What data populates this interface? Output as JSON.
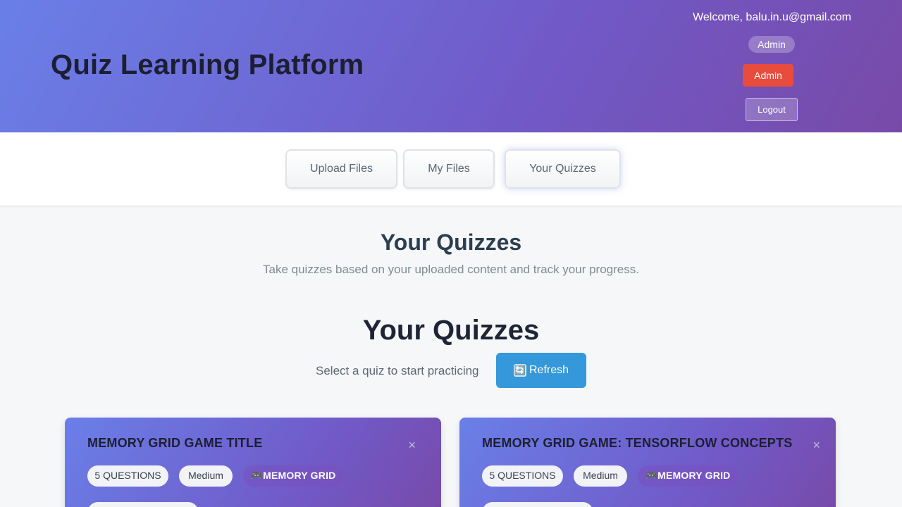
{
  "header": {
    "title": "Quiz Learning Platform",
    "welcome": "Welcome, balu.in.u@gmail.com",
    "role_badge": "Admin",
    "admin_button": "Admin",
    "logout_button": "Logout",
    "colors": {
      "gradient_start": "#6a7fe8",
      "gradient_end": "#784aa8",
      "admin": "#e74c3c"
    }
  },
  "nav": {
    "tabs": [
      {
        "label": "Upload Files"
      },
      {
        "label": "My Files"
      },
      {
        "label": "Your Quizzes"
      }
    ]
  },
  "page": {
    "heading": "Your Quizzes",
    "subtitle": "Take quizzes based on your uploaded content and track your progress."
  },
  "quizzes": {
    "heading": "Your Quizzes",
    "select_text": "Select a quiz to start practicing",
    "refresh_label": "Refresh",
    "refresh_icon": "🔄",
    "cards": [
      {
        "title": "MEMORY GRID GAME TITLE",
        "questions": "5 QUESTIONS",
        "difficulty": "Medium",
        "game_icon": "🎮",
        "game_type": "MEMORY GRID",
        "close": "×"
      },
      {
        "title": "MEMORY GRID GAME: TENSORFLOW CONCEPTS",
        "questions": "5 QUESTIONS",
        "difficulty": "Medium",
        "game_icon": "🎮",
        "game_type": "MEMORY GRID",
        "close": "×"
      }
    ]
  }
}
